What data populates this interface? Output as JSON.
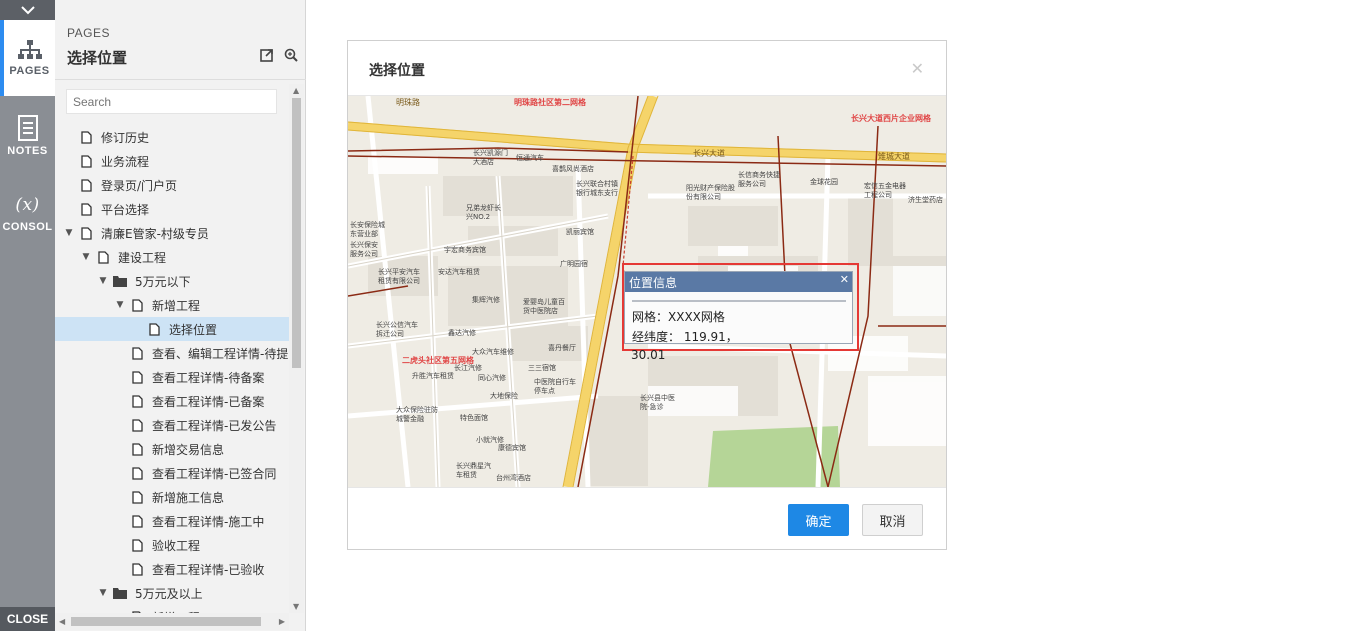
{
  "rail": {
    "pages_label": "PAGES",
    "notes_label": "NOTES",
    "console_symbol": "(x)",
    "console_label": "CONSOL",
    "close_label": "CLOSE"
  },
  "panel": {
    "kicker": "PAGES",
    "title": "选择位置",
    "search_placeholder": "Search",
    "tree": [
      {
        "label": "修订历史",
        "level": 0,
        "type": "page",
        "arrow": ""
      },
      {
        "label": "业务流程",
        "level": 0,
        "type": "page",
        "arrow": ""
      },
      {
        "label": "登录页/门户页",
        "level": 0,
        "type": "page",
        "arrow": ""
      },
      {
        "label": "平台选择",
        "level": 0,
        "type": "page",
        "arrow": ""
      },
      {
        "label": "清廉E管家-村级专员",
        "level": 0,
        "type": "page",
        "arrow": "down"
      },
      {
        "label": "建设工程",
        "level": 1,
        "type": "page",
        "arrow": "down"
      },
      {
        "label": "5万元以下",
        "level": 2,
        "type": "folder",
        "arrow": "down"
      },
      {
        "label": "新增工程",
        "level": 3,
        "type": "page",
        "arrow": "down"
      },
      {
        "label": "选择位置",
        "level": 4,
        "type": "page",
        "arrow": "",
        "selected": true
      },
      {
        "label": "查看、编辑工程详情-待提",
        "level": 3,
        "type": "page",
        "arrow": ""
      },
      {
        "label": "查看工程详情-待备案",
        "level": 3,
        "type": "page",
        "arrow": ""
      },
      {
        "label": "查看工程详情-已备案",
        "level": 3,
        "type": "page",
        "arrow": ""
      },
      {
        "label": "查看工程详情-已发公告",
        "level": 3,
        "type": "page",
        "arrow": ""
      },
      {
        "label": "新增交易信息",
        "level": 3,
        "type": "page",
        "arrow": ""
      },
      {
        "label": "查看工程详情-已签合同",
        "level": 3,
        "type": "page",
        "arrow": ""
      },
      {
        "label": "新增施工信息",
        "level": 3,
        "type": "page",
        "arrow": ""
      },
      {
        "label": "查看工程详情-施工中",
        "level": 3,
        "type": "page",
        "arrow": ""
      },
      {
        "label": "验收工程",
        "level": 3,
        "type": "page",
        "arrow": ""
      },
      {
        "label": "查看工程详情-已验收",
        "level": 3,
        "type": "page",
        "arrow": ""
      },
      {
        "label": "5万元及以上",
        "level": 2,
        "type": "folder",
        "arrow": "down"
      },
      {
        "label": "新增工程",
        "level": 3,
        "type": "page",
        "arrow": ""
      }
    ]
  },
  "dialog": {
    "title": "选择位置",
    "close_icon": "close-icon",
    "ok_label": "确定",
    "cancel_label": "取消",
    "popup": {
      "title": "位置信息",
      "grid_label": "网格：XXXX网格",
      "coord_label": "经纬度：   119.91，",
      "coord_cont": "30.01"
    },
    "map_labels": {
      "grid2": "明珠路社区第二网格",
      "grid5": "二虎头社区第五网格",
      "enterprise": "长兴大道西片企业网格",
      "road1": "明珠路",
      "road2": "长兴大道",
      "road3": "雉城大道",
      "poi1": "长兴凯源门大酒店",
      "poi2": "恒通汽车",
      "poi3": "喜鹊风尚酒店",
      "poi4": "长兴联合村镇银行城东支行",
      "poi5": "阳光财产保险股份有限公司",
      "poi6": "长信商务快捷服务公司",
      "poi7": "金球花园",
      "poi8": "宏信五金电器工程公司",
      "poi9": "济生堂药店",
      "poi10": "宇宏商务宾馆",
      "poi11": "安达汽车租赁",
      "poi12": "广明园宿",
      "poi13": "长兴平安汽车租赁有限公司",
      "poi14": "集辉汽修",
      "poi15": "爱婴岛儿童百货中医院店",
      "poi16": "长兴公信汽车拆迁公司",
      "poi17": "鑫达汽修",
      "poi18": "大众汽车维修",
      "poi19": "喜丹餐厅",
      "poi20": "长江汽修",
      "poi21": "三三宿馆",
      "poi22": "升胜汽车租赁",
      "poi23": "同心汽修",
      "poi24": "中医院自行车停车点",
      "poi25": "大地保险",
      "poi26": "长兴县中医院-急诊",
      "poi27": "大众保险驻防城警金融",
      "poi28": "特色面馆",
      "poi29": "小就汽修",
      "poi30": "康德宾馆",
      "poi31": "长兴鼎星汽车租赁",
      "poi32": "台州湾酒店",
      "poi33": "凯丽宾馆",
      "poi34": "兄弟龙虾长兴NO.2",
      "poi35": "长安保险城东营业部",
      "poi36": "长兴保安服务公司"
    }
  }
}
